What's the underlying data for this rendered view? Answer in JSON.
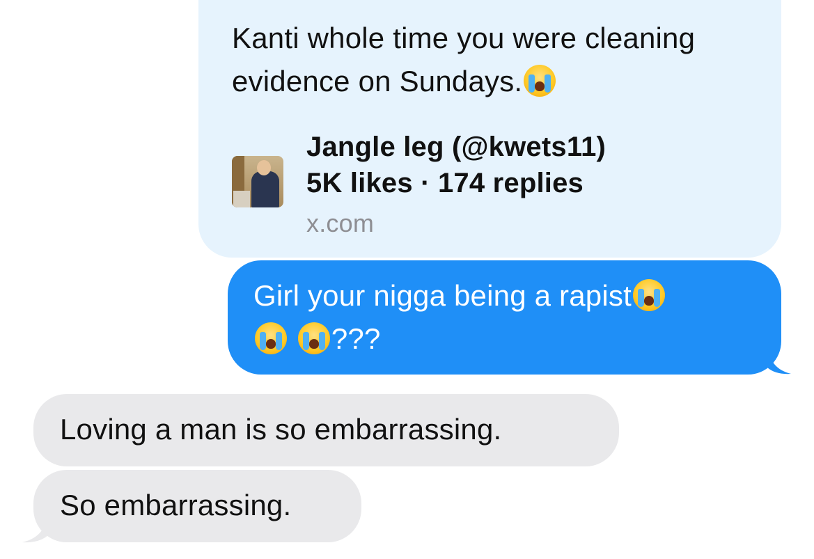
{
  "messages": [
    {
      "direction": "sent",
      "type": "link_preview",
      "text": "Kanti whole time you were cleaning evidence on Sundays.",
      "emoji": [
        "loudly-crying-face"
      ],
      "link": {
        "title": "Jangle leg (@kwets11)",
        "stats": "5K likes · 174 replies",
        "domain": "x.com",
        "thumbnail_icon": "speaker-at-podium-thumbnail"
      }
    },
    {
      "direction": "sent",
      "type": "text",
      "line1": "Girl your nigga being a rapist",
      "line2_suffix": "???",
      "emoji": [
        "loudly-crying-face",
        "loudly-crying-face",
        "loudly-crying-face"
      ]
    },
    {
      "direction": "received",
      "type": "text",
      "text": "Loving a man is so embarrassing."
    },
    {
      "direction": "received",
      "type": "text",
      "text": "So embarrassing."
    }
  ],
  "colors": {
    "sent_bubble": "#1f8ff7",
    "link_bubble": "#e6f3fd",
    "received_bubble": "#e9e9eb",
    "link_domain": "#8e8e93"
  }
}
